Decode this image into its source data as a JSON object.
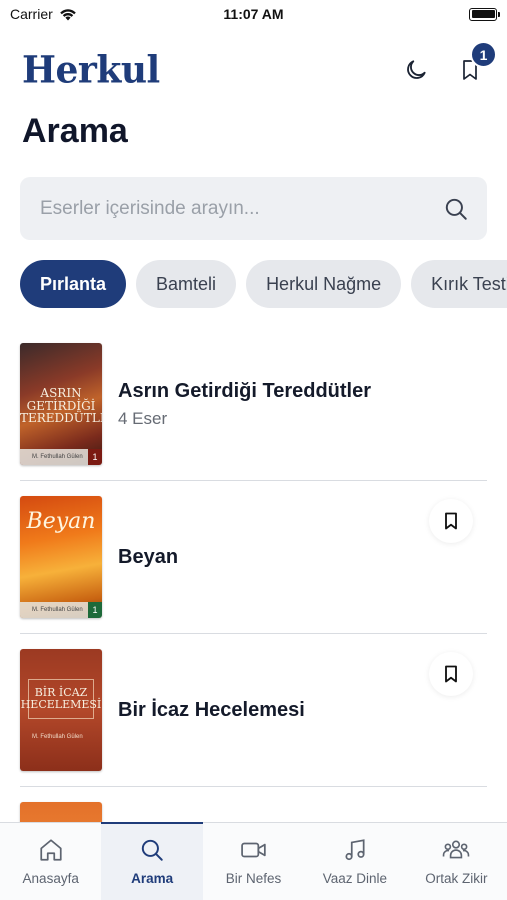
{
  "status_bar": {
    "carrier": "Carrier",
    "time": "11:07 AM"
  },
  "header": {
    "logo": "Herkul",
    "bookmark_badge": "1"
  },
  "page": {
    "title": "Arama"
  },
  "search": {
    "placeholder": "Eserler içerisinde arayın..."
  },
  "chips": [
    {
      "label": "Pırlanta",
      "active": true
    },
    {
      "label": "Bamteli",
      "active": false
    },
    {
      "label": "Herkul Nağme",
      "active": false
    },
    {
      "label": "Kırık Testi",
      "active": false
    }
  ],
  "books": [
    {
      "title": "Asrın Getirdiği Tereddütler",
      "subtitle": "4 Eser",
      "cover_text": "ASRIN GETİRDİĞİ TEREDDÜTLER",
      "cover_footer": "M. Fethullah Gülen",
      "cover_vol": "1"
    },
    {
      "title": "Beyan",
      "cover_text": "Beyan",
      "cover_footer": "M. Fethullah Gülen",
      "cover_vol": "1"
    },
    {
      "title": "Bir İcaz Hecelemesi",
      "cover_text": "BİR İCAZ HECELEMESİ",
      "cover_footer": "M. Fethullah Gülen"
    }
  ],
  "tabs": [
    {
      "label": "Anasayfa",
      "icon": "home-icon"
    },
    {
      "label": "Arama",
      "icon": "search-icon",
      "active": true
    },
    {
      "label": "Bir Nefes",
      "icon": "video-icon"
    },
    {
      "label": "Vaaz Dinle",
      "icon": "music-note-icon"
    },
    {
      "label": "Ortak Zikir",
      "icon": "group-icon"
    }
  ],
  "colors": {
    "primary": "#1f3c7a",
    "chip_bg": "#e6e8ec",
    "search_bg": "#eef0f3"
  }
}
